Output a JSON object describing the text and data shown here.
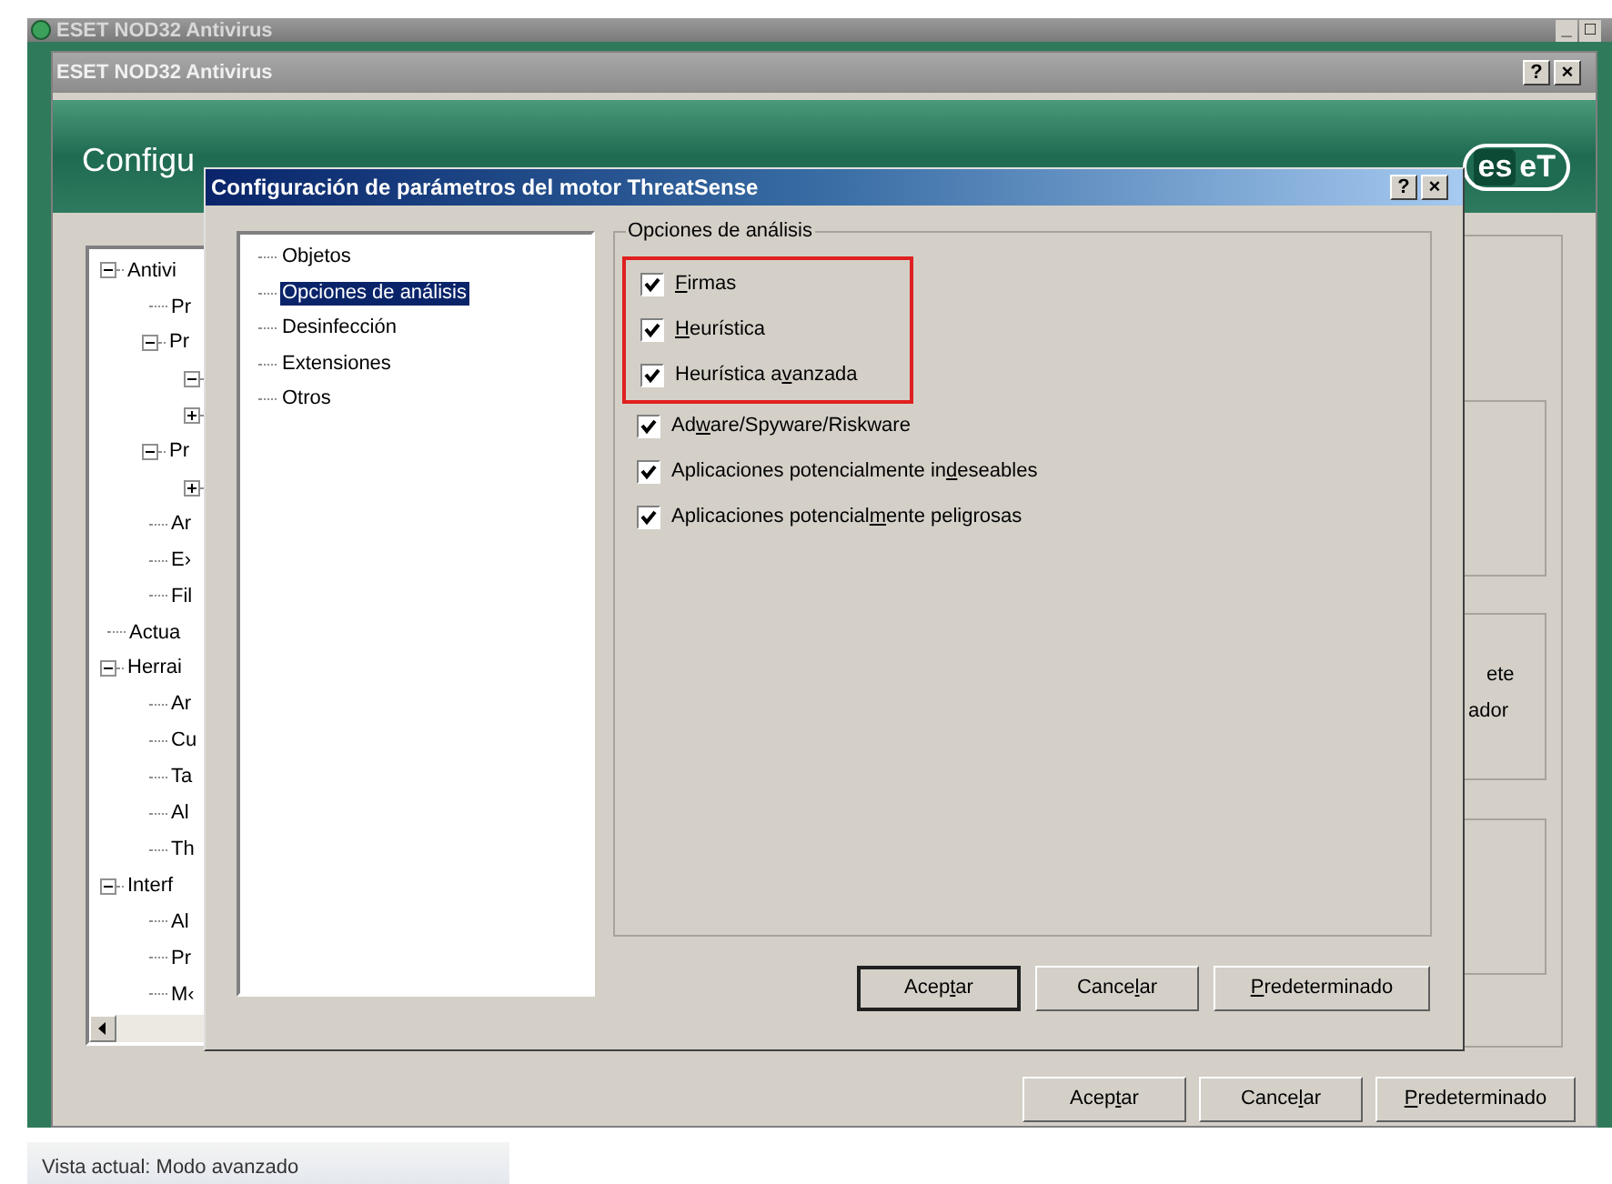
{
  "outer_window": {
    "title": "ESET NOD32 Antivirus",
    "controls": [
      "_",
      "□"
    ]
  },
  "main_window": {
    "title": "ESET NOD32 Antivirus",
    "controls": [
      "?",
      "×"
    ],
    "header": {
      "title": "Configu",
      "logo": {
        "boxed": "es",
        "rest": "eT"
      }
    },
    "tree": [
      {
        "label": "Antivi",
        "expanded": true,
        "children": [
          {
            "label": "Pr"
          },
          {
            "label": "Pr",
            "expanded": true,
            "children": [
              {
                "expanded": true
              },
              {
                "expanded": false
              }
            ]
          },
          {
            "label": "Pr",
            "expanded": true,
            "children": [
              {
                "expanded": false
              }
            ]
          },
          {
            "label": "Ar"
          },
          {
            "label": "E›"
          },
          {
            "label": "Fil"
          }
        ]
      },
      {
        "label": "Actua"
      },
      {
        "label": "Herrai",
        "expanded": true,
        "children": [
          {
            "label": "Ar"
          },
          {
            "label": "Cu"
          },
          {
            "label": "Ta"
          },
          {
            "label": "Al"
          },
          {
            "label": "Th"
          }
        ]
      },
      {
        "label": "Interf",
        "expanded": true,
        "children": [
          {
            "label": "Al"
          },
          {
            "label": "Pr"
          },
          {
            "label": "M‹"
          }
        ]
      }
    ],
    "side_texts": [
      "ete",
      "ador"
    ],
    "buttons": [
      {
        "label_parts": {
          "before": "Acep",
          "key": "t",
          "after": "ar"
        },
        "default": false
      },
      {
        "label_parts": {
          "before": "Cance",
          "key": "l",
          "after": "ar"
        },
        "default": false
      },
      {
        "label_parts": {
          "key": "P",
          "after": "redeterminado"
        },
        "default": false
      }
    ],
    "status_bar": "Vista actual: Modo avanzado"
  },
  "dialog": {
    "title": "Configuración de parámetros del motor ThreatSense",
    "controls": [
      "?",
      "×"
    ],
    "nav": [
      {
        "label": "Objetos",
        "selected": false
      },
      {
        "label": "Opciones de análisis",
        "selected": true
      },
      {
        "label": "Desinfección",
        "selected": false
      },
      {
        "label": "Extensiones",
        "selected": false
      },
      {
        "label": "Otros",
        "selected": false
      }
    ],
    "group": {
      "legend": "Opciones de análisis",
      "options": [
        {
          "label_parts": {
            "key": "F",
            "after": "irmas"
          },
          "checked": true,
          "highlighted": true
        },
        {
          "label_parts": {
            "key": "H",
            "after": "eurística"
          },
          "checked": true,
          "highlighted": true
        },
        {
          "label_parts": {
            "before": "Heurística a",
            "key": "v",
            "after": "anzada"
          },
          "checked": true,
          "highlighted": true
        },
        {
          "label_parts": {
            "before": "Ad",
            "key": "w",
            "after": "are/Spyware/Riskware"
          },
          "checked": true,
          "highlighted": false
        },
        {
          "label_parts": {
            "before": "Aplicaciones potencialmente in",
            "key": "d",
            "after": "eseables"
          },
          "checked": true,
          "highlighted": false
        },
        {
          "label_parts": {
            "before": "Aplicaciones potencial",
            "key": "m",
            "after": "ente peligrosas"
          },
          "checked": true,
          "highlighted": false
        }
      ]
    },
    "buttons": [
      {
        "label_parts": {
          "before": "Acep",
          "key": "t",
          "after": "ar"
        },
        "default": true
      },
      {
        "label_parts": {
          "before": "Cance",
          "key": "l",
          "after": "ar"
        },
        "default": false
      },
      {
        "label_parts": {
          "key": "P",
          "after": "redeterminado"
        },
        "default": false
      }
    ]
  }
}
